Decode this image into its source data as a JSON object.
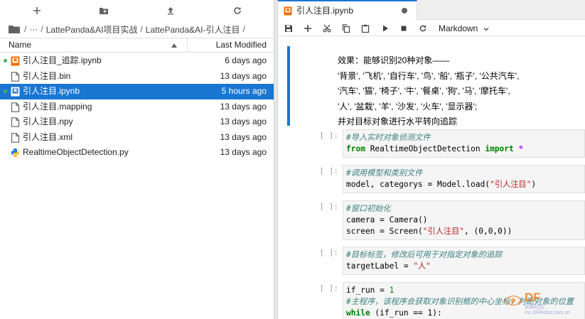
{
  "filebrowser": {
    "toolbar": {
      "new_launcher": "+",
      "new_folder": "new-folder-icon",
      "upload": "upload-icon",
      "refresh": "refresh-icon"
    },
    "breadcrumb": {
      "root": "/",
      "ellipsis": "···",
      "parts": [
        "LattePanda&AI项目实战",
        "LattePanda&AI-引人注目"
      ],
      "sep": "/"
    },
    "header": {
      "name": "Name",
      "modified": "Last Modified"
    },
    "files": [
      {
        "name": "引人注目_追踪.ipynb",
        "modified": "6 days ago",
        "icon": "notebook-icon",
        "running": true,
        "selected": false
      },
      {
        "name": "引人注目.bin",
        "modified": "13 days ago",
        "icon": "file-icon",
        "running": false,
        "selected": false
      },
      {
        "name": "引人注目.ipynb",
        "modified": "5 hours ago",
        "icon": "notebook-icon",
        "running": true,
        "selected": true
      },
      {
        "name": "引人注目.mapping",
        "modified": "13 days ago",
        "icon": "file-icon",
        "running": false,
        "selected": false
      },
      {
        "name": "引人注目.npy",
        "modified": "13 days ago",
        "icon": "file-icon",
        "running": false,
        "selected": false
      },
      {
        "name": "引人注目.xml",
        "modified": "13 days ago",
        "icon": "file-icon",
        "running": false,
        "selected": false
      },
      {
        "name": "RealtimeObjectDetection.py",
        "modified": "13 days ago",
        "icon": "python-icon",
        "running": false,
        "selected": false
      }
    ]
  },
  "notebook": {
    "tab": {
      "title": "引人注目.ipynb"
    },
    "toolbar": {
      "cell_type": "Markdown"
    },
    "markdown_lines": [
      "效果：能够识别20种对象——",
      "'背景', '飞机', '自行车', '鸟', '船', '瓶子', '公共汽车',",
      "'汽车', '猫', '椅子', '牛', '餐桌', '狗', '马', '摩托车',",
      "'人', '盆栽', '羊', '沙发', '火车', '显示器';",
      "并对目标对象进行水平转向追踪"
    ],
    "cells": [
      {
        "prompt": "[ ]:",
        "comment": "#导入实时对象侦测文件",
        "code2_kw1": "from",
        "code2_mid": " RealtimeObjectDetection ",
        "code2_kw2": "import",
        "code2_op": " *"
      },
      {
        "prompt": "[ ]:",
        "comment": "#调用模型和类别文件",
        "code2_a": "model, categorys = Model.load(",
        "code2_str": "\"引人注目\"",
        "code2_b": ")"
      },
      {
        "prompt": "[ ]:",
        "comment": "#窗口初始化",
        "code2": "camera = Camera()",
        "code3_a": "screen = Screen(",
        "code3_str": "\"引人注目\"",
        "code3_b": ", (0,0,0))"
      },
      {
        "prompt": "[ ]:",
        "comment": "#目标标签，修改后可用于对指定对象的追踪",
        "code2_a": "targetLabel = ",
        "code2_str": "\"人\""
      },
      {
        "prompt": "[ ]:",
        "code1_a": "if_run = ",
        "code1_num": "1",
        "comment": "#主程序，该程序会获取对象识别框的中心坐标，判断对象的位置",
        "code3_kw": "while",
        "code3_b": " (if_run == 1):"
      }
    ]
  },
  "watermark": {
    "text": "DF",
    "sub": "创客社区 mc.DFRobot.com.cn"
  },
  "colors": {
    "accent": "#1976d2",
    "running": "#4caf50",
    "notebook_icon": "#ef6c00",
    "python_icon": "#1976d2"
  }
}
